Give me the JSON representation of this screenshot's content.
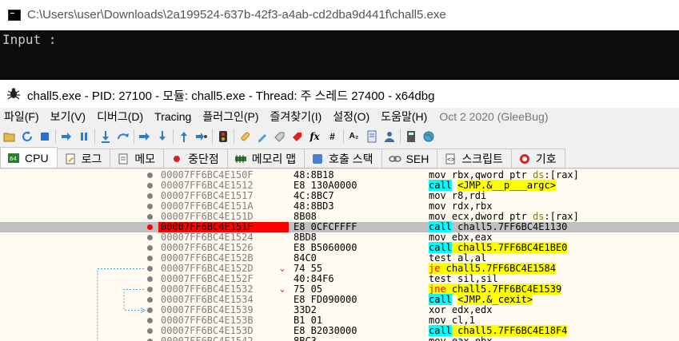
{
  "console": {
    "title": "C:\\Users\\user\\Downloads\\2a199524-637b-42f3-a4ab-cd2dba9d441f\\chall5.exe",
    "output": "Input :"
  },
  "debugger": {
    "title": "chall5.exe - PID: 27100 - 모듈: chall5.exe - Thread: 주 스레드 27400 - x64dbg",
    "menu": [
      "파일(F)",
      "보기(V)",
      "디버그(D)",
      "Tracing",
      "플러그인(P)",
      "즐겨찾기(I)",
      "설정(O)",
      "도움말(H)"
    ],
    "build_date": "Oct 2 2020 (GleeBug)",
    "tabs": [
      "CPU",
      "로그",
      "메모",
      "중단점",
      "메모리 맵",
      "호출 스택",
      "SEH",
      "스크립트",
      "기호"
    ],
    "toolbar_icons": [
      "open-icon",
      "restart-icon",
      "stop-icon",
      "run-icon",
      "pause-icon",
      "step-into-icon",
      "step-over-icon",
      "trace-into-icon",
      "trace-over-icon",
      "execute-till-return-icon",
      "run-to-user-code-icon",
      "scylla-icon",
      "patch-icon",
      "comment-icon",
      "label-icon",
      "bookmark-icon",
      "function-icon",
      "hash-icon",
      "strings-icon",
      "calculator-icon",
      "globe-icon"
    ],
    "colors": {
      "breakpoint": "#ff0000",
      "call_bg": "#00ffff",
      "jump_bg": "#ffff00",
      "selected_row": "#c0c0c0"
    }
  },
  "disasm": [
    {
      "addr": "00007FF6BC4E150F",
      "bytes": "48:8B18",
      "asm": [
        {
          "t": "mov ",
          "c": ""
        },
        {
          "t": "rbx,qword ptr ",
          "c": ""
        },
        {
          "t": "ds",
          "c": "seg"
        },
        {
          "t": ":[rax]",
          "c": ""
        }
      ],
      "bp": false,
      "sel": false,
      "arrow": ""
    },
    {
      "addr": "00007FF6BC4E1512",
      "bytes": "E8 130A0000",
      "asm": [
        {
          "t": "call",
          "c": "mn-call"
        },
        {
          "t": " ",
          "c": ""
        },
        {
          "t": "<JMP.&__p___argc>",
          "c": "hl-y"
        }
      ],
      "bp": false,
      "sel": false,
      "arrow": ""
    },
    {
      "addr": "00007FF6BC4E1517",
      "bytes": "4C:8BC7",
      "asm": [
        {
          "t": "mov r8,rdi",
          "c": ""
        }
      ],
      "bp": false,
      "sel": false,
      "arrow": ""
    },
    {
      "addr": "00007FF6BC4E151A",
      "bytes": "48:8BD3",
      "asm": [
        {
          "t": "mov rdx,rbx",
          "c": ""
        }
      ],
      "bp": false,
      "sel": false,
      "arrow": ""
    },
    {
      "addr": "00007FF6BC4E151D",
      "bytes": "8B08",
      "asm": [
        {
          "t": "mov ecx,dword ptr ",
          "c": ""
        },
        {
          "t": "ds",
          "c": "seg"
        },
        {
          "t": ":[rax]",
          "c": ""
        }
      ],
      "bp": false,
      "sel": false,
      "arrow": ""
    },
    {
      "addr": "00007FF6BC4E151F",
      "bytes": "E8 0CFCFFFF",
      "asm": [
        {
          "t": "call",
          "c": "mn-call"
        },
        {
          "t": " chall5.7FF6BC4E1130",
          "c": ""
        }
      ],
      "bp": true,
      "sel": true,
      "arrow": ""
    },
    {
      "addr": "00007FF6BC4E1524",
      "bytes": "8BD8",
      "asm": [
        {
          "t": "mov ebx,eax",
          "c": ""
        }
      ],
      "bp": false,
      "sel": false,
      "arrow": ""
    },
    {
      "addr": "00007FF6BC4E1526",
      "bytes": "E8 B5060000",
      "asm": [
        {
          "t": "call",
          "c": "mn-call"
        },
        {
          "t": " chall5.7FF6BC4E1BE0",
          "c": "hl-y"
        }
      ],
      "bp": false,
      "sel": false,
      "arrow": ""
    },
    {
      "addr": "00007FF6BC4E152B",
      "bytes": "84C0",
      "asm": [
        {
          "t": "test al,al",
          "c": ""
        }
      ],
      "bp": false,
      "sel": false,
      "arrow": ""
    },
    {
      "addr": "00007FF6BC4E152D",
      "bytes": "74 55",
      "asm": [
        {
          "t": "je",
          "c": "mn-jcc"
        },
        {
          "t": " chall5.7FF6BC4E1584",
          "c": "hl-y"
        }
      ],
      "bp": false,
      "sel": false,
      "arrow": "v"
    },
    {
      "addr": "00007FF6BC4E152F",
      "bytes": "40:84F6",
      "asm": [
        {
          "t": "test sil,sil",
          "c": ""
        }
      ],
      "bp": false,
      "sel": false,
      "arrow": ""
    },
    {
      "addr": "00007FF6BC4E1532",
      "bytes": "75 05",
      "asm": [
        {
          "t": "jne",
          "c": "mn-jcc"
        },
        {
          "t": " chall5.7FF6BC4E1539",
          "c": "hl-y"
        }
      ],
      "bp": false,
      "sel": false,
      "arrow": "v"
    },
    {
      "addr": "00007FF6BC4E1534",
      "bytes": "E8 FD090000",
      "asm": [
        {
          "t": "call",
          "c": "mn-call"
        },
        {
          "t": " ",
          "c": ""
        },
        {
          "t": "<JMP.&_cexit>",
          "c": "hl-y"
        }
      ],
      "bp": false,
      "sel": false,
      "arrow": ""
    },
    {
      "addr": "00007FF6BC4E1539",
      "bytes": "33D2",
      "asm": [
        {
          "t": "xor edx,edx",
          "c": ""
        }
      ],
      "bp": false,
      "sel": false,
      "arrow": ""
    },
    {
      "addr": "00007FF6BC4E153B",
      "bytes": "B1 01",
      "asm": [
        {
          "t": "mov cl,1",
          "c": ""
        }
      ],
      "bp": false,
      "sel": false,
      "arrow": ""
    },
    {
      "addr": "00007FF6BC4E153D",
      "bytes": "E8 B2030000",
      "asm": [
        {
          "t": "call",
          "c": "mn-call"
        },
        {
          "t": " chall5.7FF6BC4E18F4",
          "c": "hl-y"
        }
      ],
      "bp": false,
      "sel": false,
      "arrow": ""
    },
    {
      "addr": "00007FF6BC4E1542",
      "bytes": "8BC3",
      "asm": [
        {
          "t": "mov eax,ebx",
          "c": ""
        }
      ],
      "bp": false,
      "sel": false,
      "arrow": ""
    }
  ]
}
